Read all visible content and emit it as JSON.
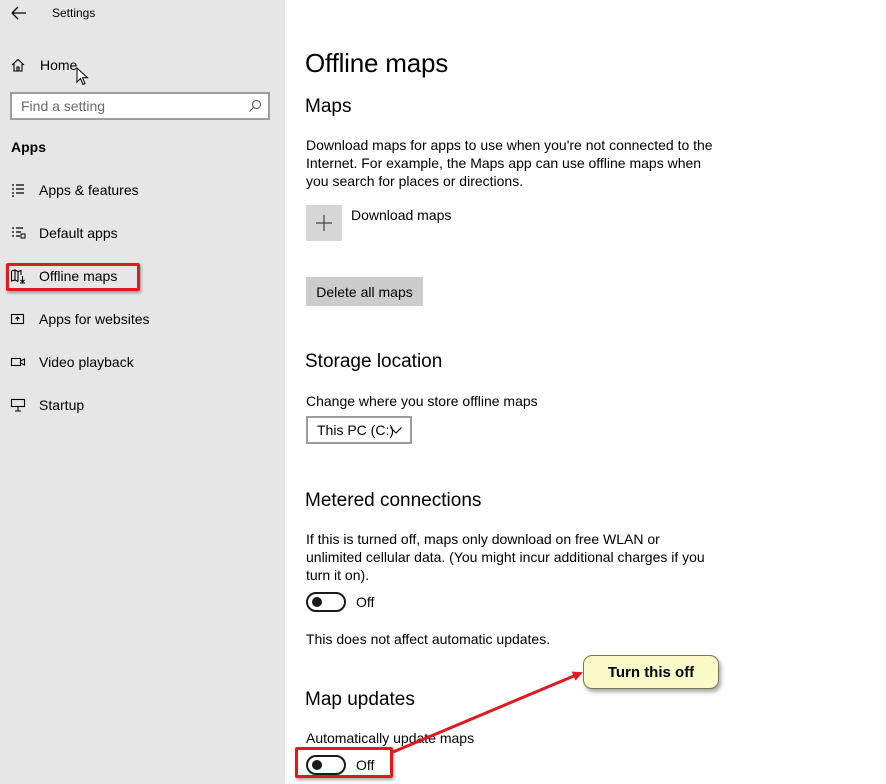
{
  "window": {
    "title": "Settings"
  },
  "sidebar": {
    "home_label": "Home",
    "search_placeholder": "Find a setting",
    "section_heading": "Apps",
    "items": [
      {
        "label": "Apps & features",
        "icon": "list-icon"
      },
      {
        "label": "Default apps",
        "icon": "default-apps-icon"
      },
      {
        "label": "Offline maps",
        "icon": "map-download-icon",
        "highlighted": true
      },
      {
        "label": "Apps for websites",
        "icon": "open-in-app-icon"
      },
      {
        "label": "Video playback",
        "icon": "video-icon"
      },
      {
        "label": "Startup",
        "icon": "startup-icon"
      }
    ]
  },
  "main": {
    "title": "Offline maps",
    "maps": {
      "heading": "Maps",
      "description": "Download maps for apps to use when you're not connected to the Internet. For example, the Maps app can use offline maps when you search for places or directions.",
      "download_label": "Download maps",
      "delete_button": "Delete all maps"
    },
    "storage": {
      "heading": "Storage location",
      "label": "Change where you store offline maps",
      "selected": "This PC (C:)"
    },
    "metered": {
      "heading": "Metered connections",
      "description": "If this is turned off, maps only download on free WLAN or unlimited cellular data. (You might incur additional charges if you turn it on).",
      "toggle_state": "Off",
      "note": "This does not affect automatic updates."
    },
    "updates": {
      "heading": "Map updates",
      "label": "Automatically update maps",
      "toggle_state": "Off"
    }
  },
  "annotation": {
    "callout_text": "Turn this off",
    "highlight_color": "#e0191f"
  }
}
